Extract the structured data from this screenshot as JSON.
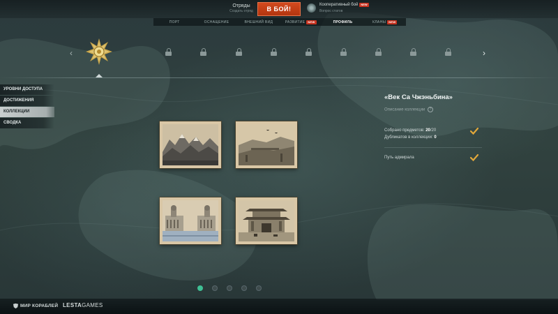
{
  "topbar": {
    "squad_title": "Отряды",
    "squad_sub": "Создать отряд",
    "battle_label": "В БОЙ!",
    "mode_title": "Кооперативный бой",
    "mode_sub": "Вопрос статов",
    "mode_badge": "NEW"
  },
  "nav": {
    "items": [
      {
        "label": "ПОРТ",
        "badge": ""
      },
      {
        "label": "ОСНАЩЕНИЕ",
        "badge": ""
      },
      {
        "label": "ВНЕШНИЙ ВИД",
        "badge": ""
      },
      {
        "label": "РАЗВИТИЕ",
        "badge": "NEW"
      },
      {
        "label": "ПРОФИЛЬ",
        "badge": ""
      },
      {
        "label": "КЛАНЫ",
        "badge": "NEW"
      }
    ],
    "active": "ПРОФИЛЬ"
  },
  "medals": {
    "locked_count": 10,
    "left_arrow": "‹",
    "right_arrow": "›"
  },
  "sidebar": {
    "items": [
      {
        "label": "УРОВНИ ДОСТУПА"
      },
      {
        "label": "ДОСТИЖЕНИЯ"
      },
      {
        "label": "КОЛЛЕКЦИИ"
      },
      {
        "label": "СВОДКА"
      }
    ],
    "active": "КОЛЛЕКЦИИ"
  },
  "collection": {
    "title": "«Век Са Чжэньбина»",
    "description_label": "Описание коллекции",
    "help_icon": "?",
    "collected_label": "Собрано предметов:",
    "collected_value": "20",
    "collected_total": "/20",
    "duplicates_label": "Дубликатов в коллекции:",
    "duplicates_value": "0",
    "reward_label": "Путь адмирала",
    "cards": [
      {
        "name": "mountains-card",
        "icon": "mountain-landscape"
      },
      {
        "name": "valley-card",
        "icon": "valley-landscape"
      },
      {
        "name": "naval-college-card",
        "icon": "domed-buildings"
      },
      {
        "name": "city-gate-card",
        "icon": "chinese-gate"
      }
    ]
  },
  "pagination": {
    "count": 5,
    "active": 0
  },
  "footer": {
    "logo1": "МИР КОРАБЛЕЙ",
    "logo2_a": "LESTA",
    "logo2_b": "GAMES"
  },
  "colors": {
    "accent": "#c24119",
    "active_dot": "#3fbf94",
    "check": "#e2a83a"
  }
}
